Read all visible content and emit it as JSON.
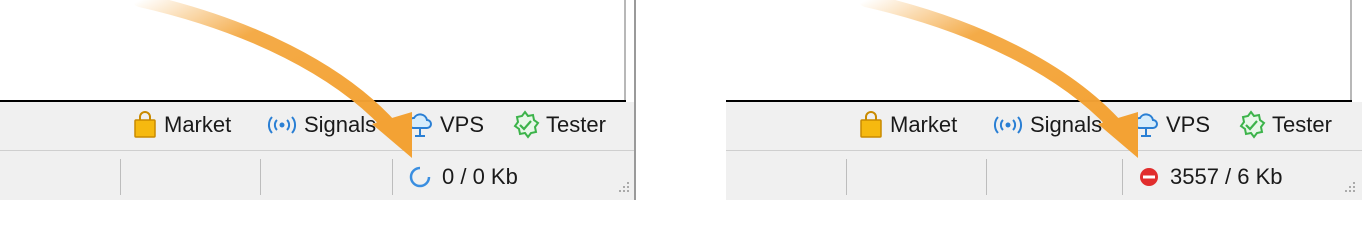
{
  "left": {
    "tabs": [
      {
        "label": "Market",
        "icon": "shopping-bag-icon"
      },
      {
        "label": "Signals",
        "icon": "broadcast-signal-icon"
      },
      {
        "label": "VPS",
        "icon": "cloud-server-icon"
      },
      {
        "label": "Tester",
        "icon": "gear-check-icon"
      }
    ],
    "status": {
      "traffic": "0 / 0 Kb",
      "connection_icon": "connecting-spinner-icon"
    }
  },
  "right": {
    "tabs": [
      {
        "label": "Market",
        "icon": "shopping-bag-icon"
      },
      {
        "label": "Signals",
        "icon": "broadcast-signal-icon"
      },
      {
        "label": "VPS",
        "icon": "cloud-server-icon"
      },
      {
        "label": "Tester",
        "icon": "gear-check-icon"
      }
    ],
    "status": {
      "traffic": "3557 / 6 Kb",
      "connection_icon": "no-connection-icon"
    }
  },
  "colors": {
    "arrow": "#f3a234",
    "bag": "#f6b90f",
    "signals": "#2a7fd4",
    "vps": "#2a7fd4",
    "tester": "#3cb34a",
    "error": "#e12d2d",
    "spinner": "#3a8ee0"
  }
}
